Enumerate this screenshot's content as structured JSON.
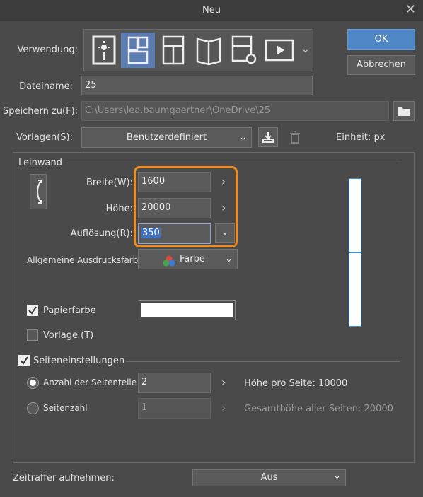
{
  "window": {
    "title": "Neu"
  },
  "usage": {
    "label": "Verwendung:",
    "icons": [
      "illustration-icon",
      "comic-icon",
      "webtoon-icon",
      "book-icon",
      "print-icon",
      "animation-icon"
    ],
    "selected_index": 1
  },
  "buttons": {
    "ok": "OK",
    "cancel": "Abbrechen"
  },
  "filename": {
    "label": "Dateiname:",
    "value": "25"
  },
  "save_to": {
    "label": "Speichern zu(F):",
    "value": "C:\\Users\\lea.baumgaertner\\OneDrive\\25"
  },
  "templates": {
    "label": "Vorlagen(S):",
    "value": "Benutzerdefiniert"
  },
  "unit": {
    "label": "Einheit:",
    "value": "px"
  },
  "canvas": {
    "section_label": "Leinwand",
    "width": {
      "label": "Breite(W):",
      "value": "1600"
    },
    "height": {
      "label": "Höhe:",
      "value": "20000"
    },
    "resolution": {
      "label": "Auflösung(R):",
      "value": "350"
    },
    "print_color": {
      "label": "Allgemeine Ausdrucksfarbe:",
      "value": "Farbe"
    },
    "paper_color": {
      "label": "Papierfarbe",
      "checked": true,
      "color": "#ffffff"
    },
    "template": {
      "label": "Vorlage (T)",
      "checked": false
    }
  },
  "page_settings": {
    "label": "Seiteneinstellungen",
    "checked": true,
    "split_count": {
      "label": "Anzahl der Seitenteile",
      "value": "2",
      "selected": true,
      "info": "Höhe pro Seite: 10000"
    },
    "page_count": {
      "label": "Seitenzahl",
      "value": "1",
      "selected": false,
      "info": "Gesamthöhe aller Seiten: 20000"
    }
  },
  "timelapse": {
    "label": "Zeitraffer aufnehmen:",
    "value": "Aus"
  },
  "colors": {
    "accent": "#f08c1e",
    "selected": "#5b7db1",
    "primary_button": "#4f86c6",
    "preview_border": "#3b8fd6"
  }
}
